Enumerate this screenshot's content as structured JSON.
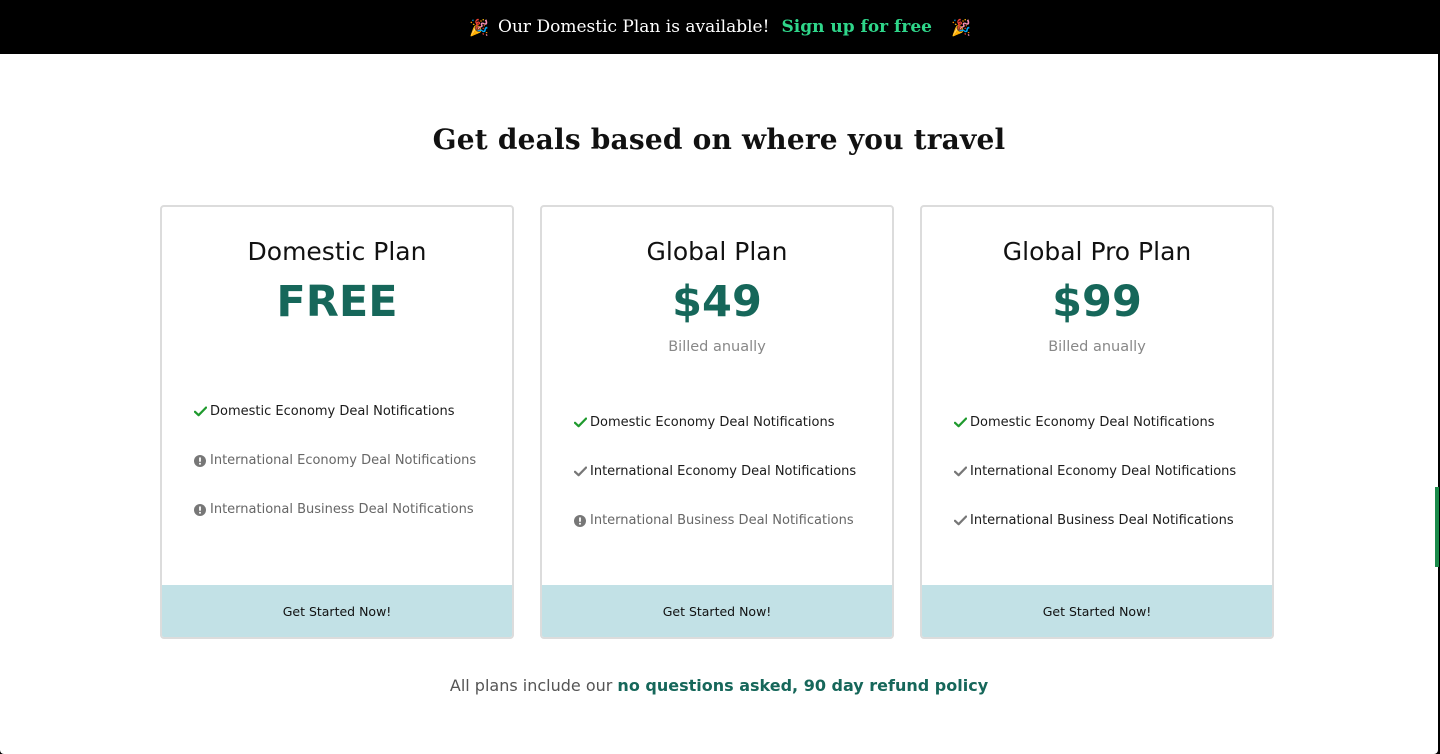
{
  "banner": {
    "left_emoji": "🎉",
    "text": "Our Domestic Plan is available!",
    "link": "Sign up for free",
    "right_emoji": "🎉"
  },
  "headline": "Get deals based on where you travel",
  "plans": [
    {
      "title": "Domestic Plan",
      "price": "FREE",
      "billing": "",
      "features": [
        {
          "label": "Domestic Economy Deal Notifications",
          "status": "included-green"
        },
        {
          "label": "International Economy Deal Notifications",
          "status": "not-included"
        },
        {
          "label": "International Business Deal Notifications",
          "status": "not-included"
        }
      ],
      "cta": "Get Started Now!"
    },
    {
      "title": "Global Plan",
      "price": "$49",
      "billing": "Billed anually",
      "features": [
        {
          "label": "Domestic Economy Deal Notifications",
          "status": "included-green"
        },
        {
          "label": "International Economy Deal Notifications",
          "status": "included-gray"
        },
        {
          "label": "International Business Deal Notifications",
          "status": "not-included"
        }
      ],
      "cta": "Get Started Now!"
    },
    {
      "title": "Global Pro Plan",
      "price": "$99",
      "billing": "Billed anually",
      "features": [
        {
          "label": "Domestic Economy Deal Notifications",
          "status": "included-green"
        },
        {
          "label": "International Economy Deal Notifications",
          "status": "included-gray"
        },
        {
          "label": "International Business Deal Notifications",
          "status": "included-gray"
        }
      ],
      "cta": "Get Started Now!"
    }
  ],
  "refund": {
    "text": "All plans include our",
    "link": "no questions asked, 90 day refund policy"
  },
  "colors": {
    "accent": "#16675a",
    "banner_link": "#2fd68a",
    "cta_bg": "#c2e1e6",
    "check_green": "#1f9a2e",
    "check_gray": "#777777",
    "info_gray": "#777777"
  }
}
